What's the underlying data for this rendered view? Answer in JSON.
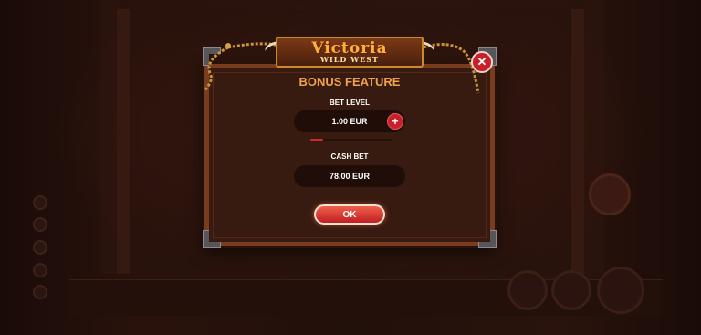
{
  "game": {
    "logo_main": "Victoria",
    "logo_sub": "WILD WEST"
  },
  "dialog": {
    "title": "BONUS FEATURE",
    "bet_level_label": "BET LEVEL",
    "bet_level_value": "1.00 EUR",
    "decrease_symbol": "−",
    "increase_symbol": "+",
    "bet_level_progress": 0.15,
    "cash_bet_label": "CASH BET",
    "cash_bet_value": "78.00 EUR",
    "ok_label": "OK",
    "close_symbol": "✕"
  },
  "colors": {
    "accent_red": "#c8202a",
    "title_orange": "#f0a24a",
    "frame_brown": "#7a3c1e"
  },
  "icons": {
    "close": "close-icon",
    "minus": "minus-icon",
    "plus": "plus-icon"
  }
}
